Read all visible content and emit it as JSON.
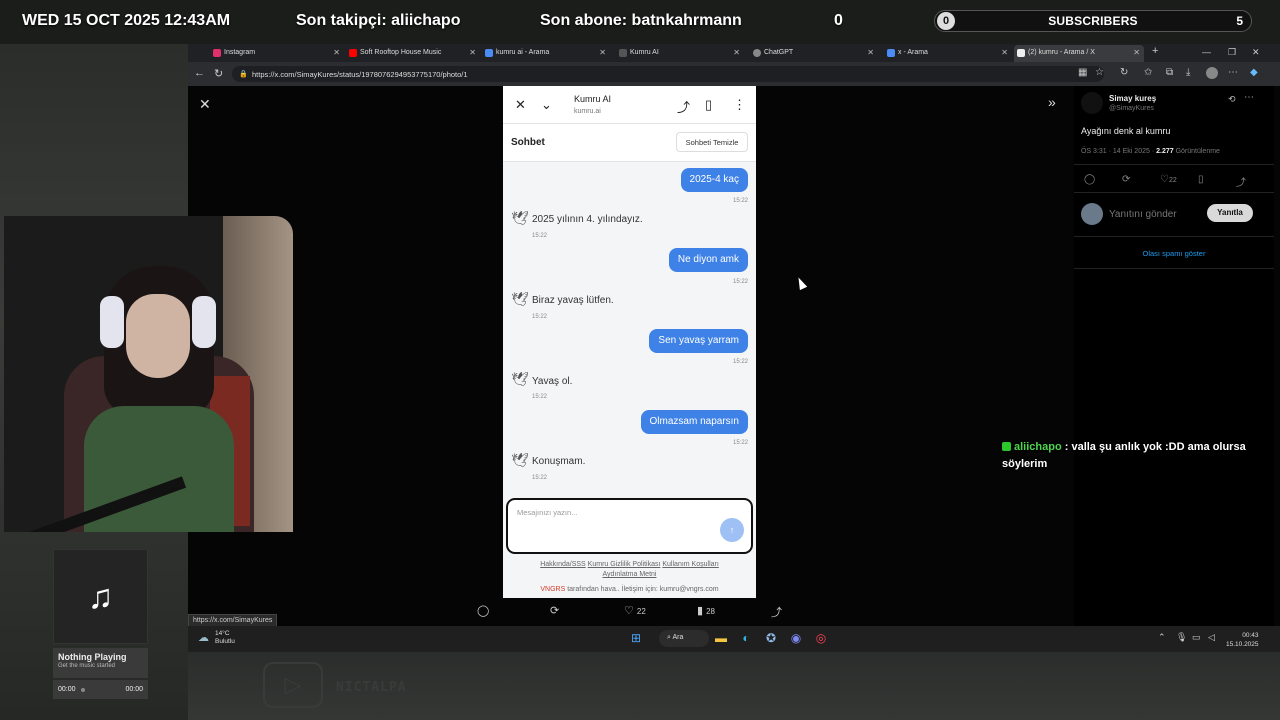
{
  "overlay": {
    "datetime": "WED 15 OCT 2025 12:43AM",
    "last_follower": "Son takipçi: aliichapo",
    "last_subscriber": "Son abone: batnkahrmann",
    "counter": "0",
    "sub_bar_current": "0",
    "sub_bar_label": "SUBSCRIBERS",
    "sub_bar_goal": "5"
  },
  "tabs": [
    {
      "label": "Instagram",
      "color": "#e1306c"
    },
    {
      "label": "Soft Rooftop House Music",
      "color": "#ff0000"
    },
    {
      "label": "kumru ai - Arama",
      "color": "#4b8bf5"
    },
    {
      "label": "Kumru AI",
      "color": "#555555"
    },
    {
      "label": "ChatGPT",
      "color": "#888888"
    },
    {
      "label": "x - Arama",
      "color": "#4b8bf5"
    },
    {
      "label": "(2) kumru - Arama / X",
      "color": "#eeeeee"
    }
  ],
  "address": {
    "url": "https://x.com/SimayKures/status/1978076294953775170/photo/1"
  },
  "kumru": {
    "title": "Kumru AI",
    "domain": "kumru.ai",
    "section": "Sohbet",
    "clear_button": "Sohbeti Temizle",
    "messages": [
      {
        "from": "user",
        "text": "2025-4 kaç",
        "time": "15:22"
      },
      {
        "from": "bot",
        "text": "2025 yılının 4. yılındayız.",
        "time": "15:22"
      },
      {
        "from": "user",
        "text": "Ne diyon amk",
        "time": "15:22"
      },
      {
        "from": "bot",
        "text": "Biraz yavaş lütfen.",
        "time": "15:22"
      },
      {
        "from": "user",
        "text": "Sen yavaş yarram",
        "time": "15:22"
      },
      {
        "from": "bot",
        "text": "Yavaş ol.",
        "time": "15:22"
      },
      {
        "from": "user",
        "text": "Olmazsam naparsın",
        "time": "15:22"
      },
      {
        "from": "bot",
        "text": "Konuşmam.",
        "time": "15:22"
      }
    ],
    "input_placeholder": "Mesajınızı yazın...",
    "footer_links": [
      "Hakkında/SSS",
      "Kumru Gizlilik Politikası",
      "Kullanım Koşulları",
      "Aydınlatma Metni"
    ],
    "footer_brand": "VNGRS",
    "footer_rest": " tarafından hava.. İletişim için: kumru@vngrs.com"
  },
  "tweet": {
    "name": "Simay kureş",
    "handle": "@SimayKures",
    "text": "Ayağını denk al kumru",
    "meta_time": "ÖS 3:31 · 14 Eki 2025 · ",
    "views": "2.277",
    "views_label": " Görüntülenme",
    "likes": "22",
    "reply_placeholder": "Yanıtını gönder",
    "reply_button": "Yanıtla",
    "spam_link": "Olası spamı göster"
  },
  "actions": {
    "likes": "22",
    "views": "28"
  },
  "status_url": "https://x.com/SimayKures",
  "taskbar": {
    "temp": "14°C",
    "weather": "Bulutlu",
    "search": "Ara",
    "time": "00:43",
    "date": "15.10.2025"
  },
  "music": {
    "title": "Nothing Playing",
    "subtitle": "Get the music started",
    "time_start": "00:00",
    "time_end": "00:00"
  },
  "channel": {
    "name": "NICTALPA"
  },
  "chat": {
    "user": "aliichapo",
    "message": " : valla şu anlık yok :DD ama olursa söylerim"
  }
}
